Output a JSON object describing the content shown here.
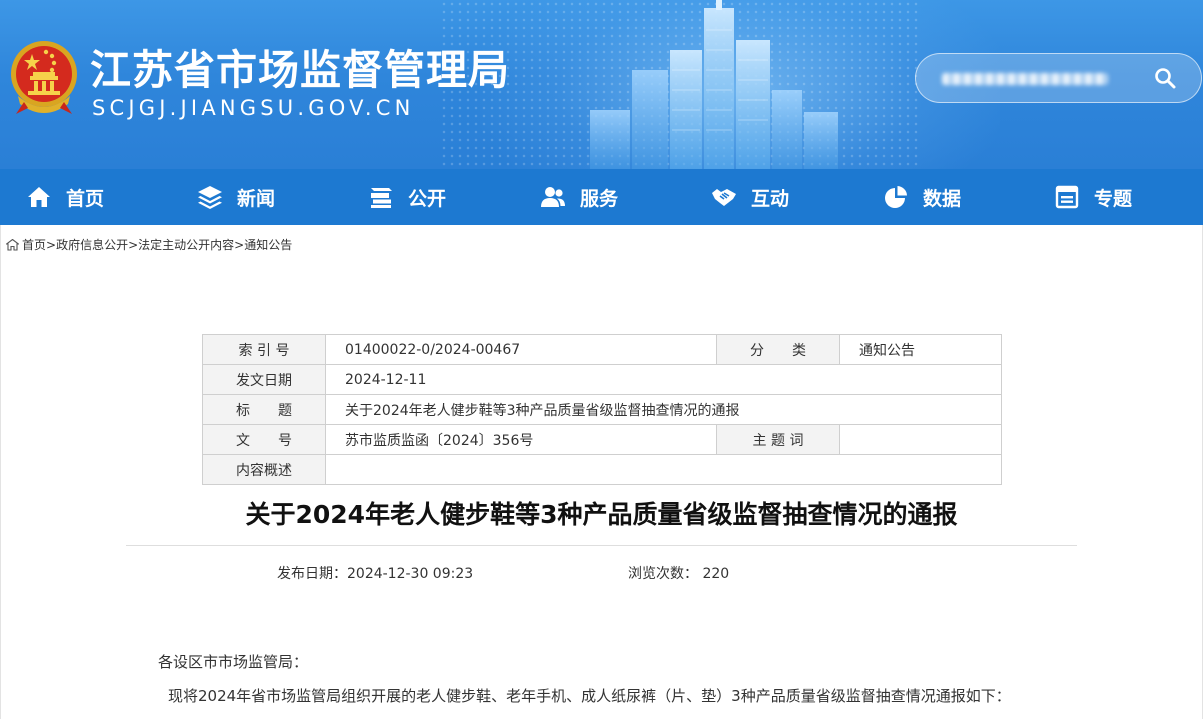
{
  "header": {
    "site_title": "江苏省市场监督管理局",
    "site_domain": "SCJGJ.JIANGSU.GOV.CN",
    "search_placeholder": ""
  },
  "nav": {
    "items": [
      {
        "label": "首页",
        "icon": "home-icon"
      },
      {
        "label": "新闻",
        "icon": "layers-icon"
      },
      {
        "label": "公开",
        "icon": "stack-icon"
      },
      {
        "label": "服务",
        "icon": "users-icon"
      },
      {
        "label": "互动",
        "icon": "handshake-icon"
      },
      {
        "label": "数据",
        "icon": "pie-chart-icon"
      },
      {
        "label": "专题",
        "icon": "window-icon"
      }
    ]
  },
  "breadcrumb": {
    "items": [
      "首页",
      "政府信息公开",
      "法定主动公开内容",
      "通知公告"
    ],
    "separator": ">"
  },
  "meta": {
    "index_label": "索 引 号",
    "index_value": "01400022-0/2024-00467",
    "category_label": "分　　类",
    "category_value": "通知公告",
    "date_label": "发文日期",
    "date_value": "2024-12-11",
    "title_label": "标　　题",
    "title_value": "关于2024年老人健步鞋等3种产品质量省级监督抽查情况的通报",
    "doc_no_label": "文　　号",
    "doc_no_value": "苏市监质监函〔2024〕356号",
    "subject_label": "主 题 词",
    "subject_value": "",
    "summary_label": "内容概述",
    "summary_value": ""
  },
  "article": {
    "title": "关于2024年老人健步鞋等3种产品质量省级监督抽查情况的通报",
    "publish_label": "发布日期：",
    "publish_value": "2024-12-30 09:23",
    "views_label": "浏览次数：",
    "views_value": "220",
    "salutation": "各设区市市场监管局：",
    "intro": "现将2024年省市场监管局组织开展的老人健步鞋、老年手机、成人纸尿裤（片、垫）3种产品质量省级监督抽查情况通报如下："
  },
  "colors": {
    "banner": "#2f86db",
    "nav": "#1d79d1",
    "table_label_bg": "#f3f3f3"
  }
}
